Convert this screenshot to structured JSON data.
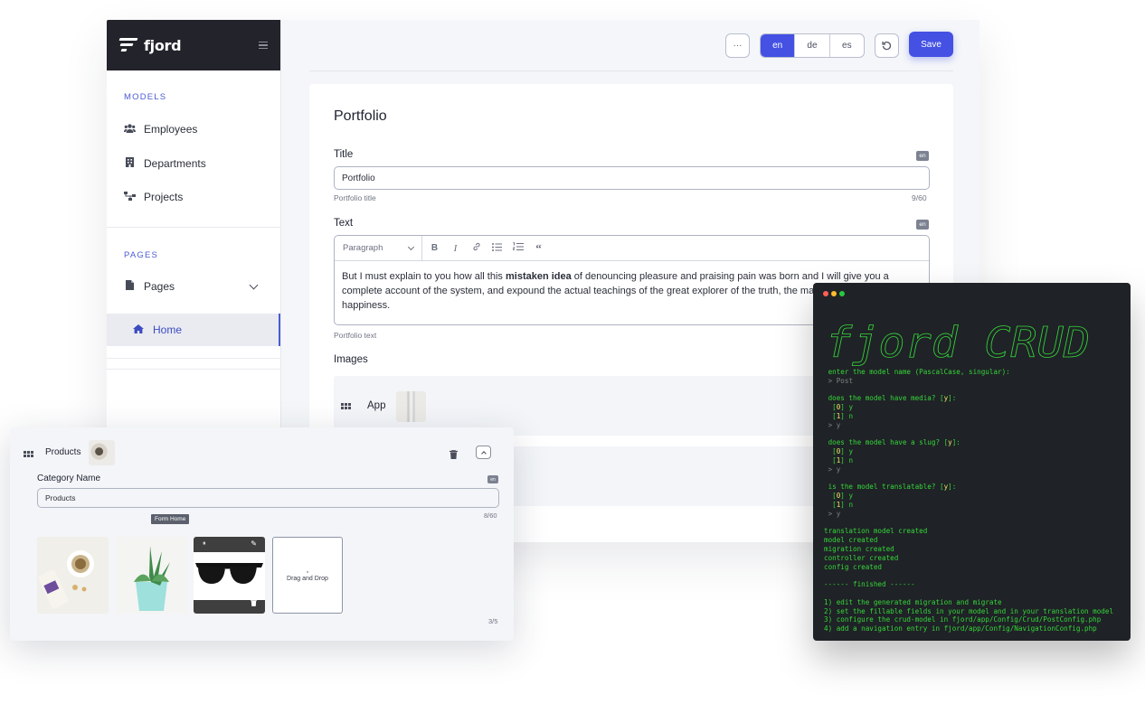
{
  "brand": {
    "name": "fjord"
  },
  "sidebar": {
    "sections": [
      {
        "label": "MODELS"
      },
      {
        "label": "PAGES"
      }
    ],
    "items": [
      {
        "label": "Employees",
        "icon": "users-icon"
      },
      {
        "label": "Departments",
        "icon": "building-icon"
      },
      {
        "label": "Projects",
        "icon": "sitemap-icon"
      },
      {
        "label": "Pages",
        "icon": "file-icon"
      },
      {
        "label": "Home",
        "icon": "home-icon"
      }
    ]
  },
  "toolbar": {
    "more_label": "···",
    "languages": [
      "en",
      "de",
      "es"
    ],
    "active_language": "en",
    "save_label": "Save"
  },
  "form": {
    "title": "Portfolio",
    "fields": {
      "title": {
        "label": "Title",
        "lang": "en",
        "value": "Portfolio",
        "hint": "Portfolio title",
        "count": "9/60"
      },
      "text": {
        "label": "Text",
        "lang": "en",
        "format": "Paragraph",
        "hint": "Portfolio text",
        "body_before": "But I must explain to you how all this ",
        "body_bold": "mistaken idea",
        "body_after": " of denouncing pleasure and praising pain was born and I will give you a complete account of the system, and expound the actual teachings of the great explorer of the truth, the master-builder of human happiness."
      },
      "images": {
        "label": "Images",
        "first_row": "App"
      }
    }
  },
  "products": {
    "title": "Products",
    "category_label": "Category Name",
    "lang": "en",
    "category_value": "Products",
    "count": "8/60",
    "tooltip": "Form Home",
    "drop_label": "Drag and Drop",
    "image_count": "3/5"
  },
  "terminal": {
    "ascii_title": "fjord CRUD",
    "lines": [
      {
        "text": " enter the model name (PascalCase, singular):",
        "kind": "out"
      },
      {
        "text": " > Post",
        "kind": "dim"
      },
      {
        "text": "",
        "kind": "out"
      },
      {
        "text": " does the model have media? [y]:",
        "kind": "out"
      },
      {
        "text": "  [0] y",
        "kind": "opt"
      },
      {
        "text": "  [1] n",
        "kind": "opt"
      },
      {
        "text": " > y",
        "kind": "dim"
      },
      {
        "text": "",
        "kind": "out"
      },
      {
        "text": " does the model have a slug? [y]:",
        "kind": "out"
      },
      {
        "text": "  [0] y",
        "kind": "opt"
      },
      {
        "text": "  [1] n",
        "kind": "opt"
      },
      {
        "text": " > y",
        "kind": "dim"
      },
      {
        "text": "",
        "kind": "out"
      },
      {
        "text": " is the model translatable? [y]:",
        "kind": "out"
      },
      {
        "text": "  [0] y",
        "kind": "opt"
      },
      {
        "text": "  [1] n",
        "kind": "opt"
      },
      {
        "text": " > y",
        "kind": "dim"
      },
      {
        "text": "",
        "kind": "out"
      },
      {
        "text": "translation model created",
        "kind": "out"
      },
      {
        "text": "model created",
        "kind": "out"
      },
      {
        "text": "migration created",
        "kind": "out"
      },
      {
        "text": "controller created",
        "kind": "out"
      },
      {
        "text": "config created",
        "kind": "out"
      },
      {
        "text": "",
        "kind": "out"
      },
      {
        "text": "------ finished ------",
        "kind": "out"
      },
      {
        "text": "",
        "kind": "out"
      },
      {
        "text": "1) edit the generated migration and migrate",
        "kind": "out"
      },
      {
        "text": "2) set the fillable fields in your model and in your translation model",
        "kind": "out"
      },
      {
        "text": "3) configure the crud-model in fjord/app/Config/Crud/PostConfig.php",
        "kind": "out"
      },
      {
        "text": "4) add a navigation entry in fjord/app/Config/NavigationConfig.php",
        "kind": "out"
      }
    ]
  },
  "colors": {
    "accent": "#4451e3",
    "sidebar_dark": "#22232b",
    "terminal_green": "#35d63a"
  }
}
